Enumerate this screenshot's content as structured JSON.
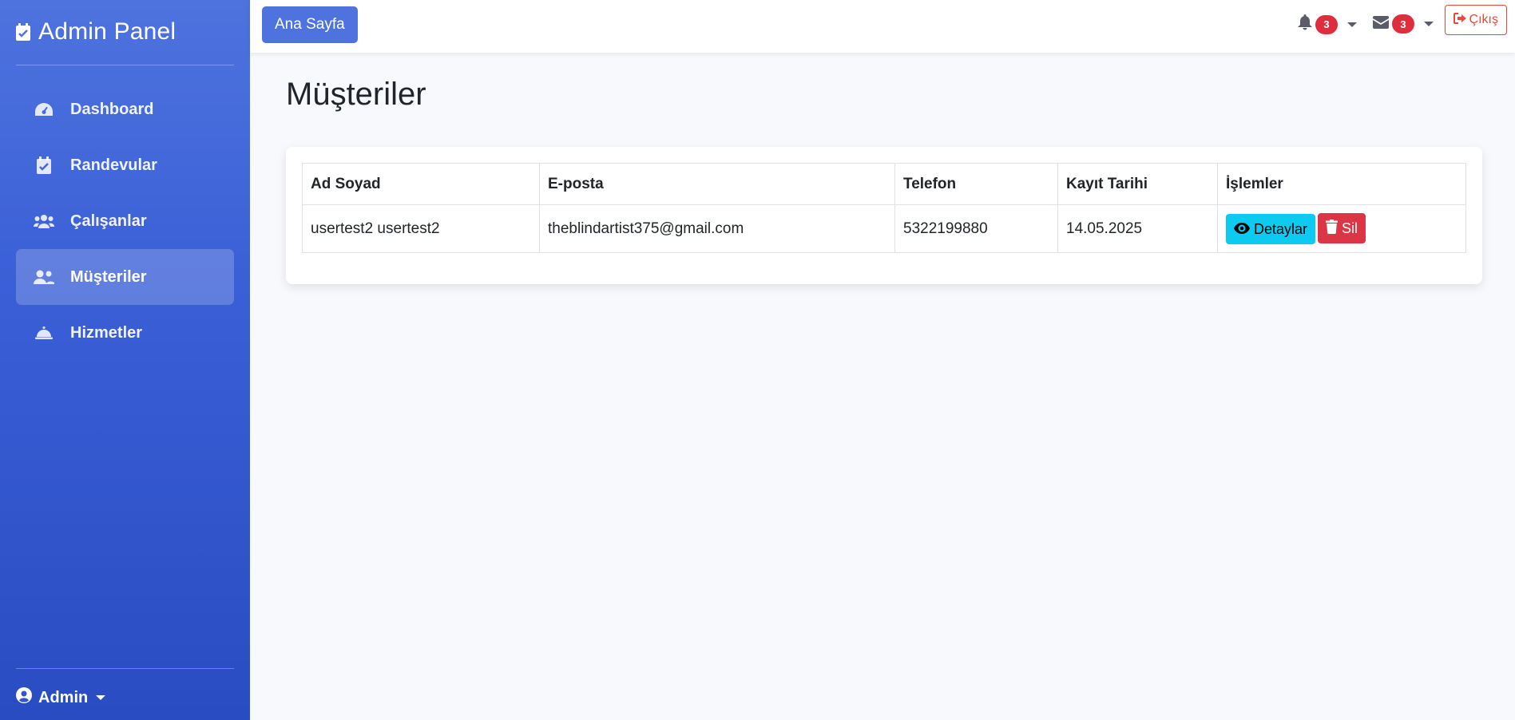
{
  "sidebar": {
    "brand": "Admin Panel",
    "items": [
      {
        "label": "Dashboard",
        "icon": "gauge-icon"
      },
      {
        "label": "Randevular",
        "icon": "calendar-check-icon"
      },
      {
        "label": "Çalışanlar",
        "icon": "users-icon"
      },
      {
        "label": "Müşteriler",
        "icon": "user-group-icon",
        "active": true
      },
      {
        "label": "Hizmetler",
        "icon": "service-bell-icon"
      }
    ],
    "user_label": "Admin"
  },
  "topbar": {
    "home_label": "Ana Sayfa",
    "notifications_count": "3",
    "messages_count": "3",
    "logout_label": "Çıkış"
  },
  "main": {
    "title": "Müşteriler",
    "table": {
      "headers": [
        "Ad Soyad",
        "E-posta",
        "Telefon",
        "Kayıt Tarihi",
        "İşlemler"
      ],
      "rows": [
        {
          "name": "usertest2 usertest2",
          "email": "theblindartist375@gmail.com",
          "phone": "5322199880",
          "date": "14.05.2025"
        }
      ],
      "details_label": "Detaylar",
      "delete_label": "Sil"
    }
  },
  "colors": {
    "primary": "#4e73df",
    "danger": "#dc3545",
    "info": "#0dcaf0",
    "badge": "#e02d3d"
  }
}
